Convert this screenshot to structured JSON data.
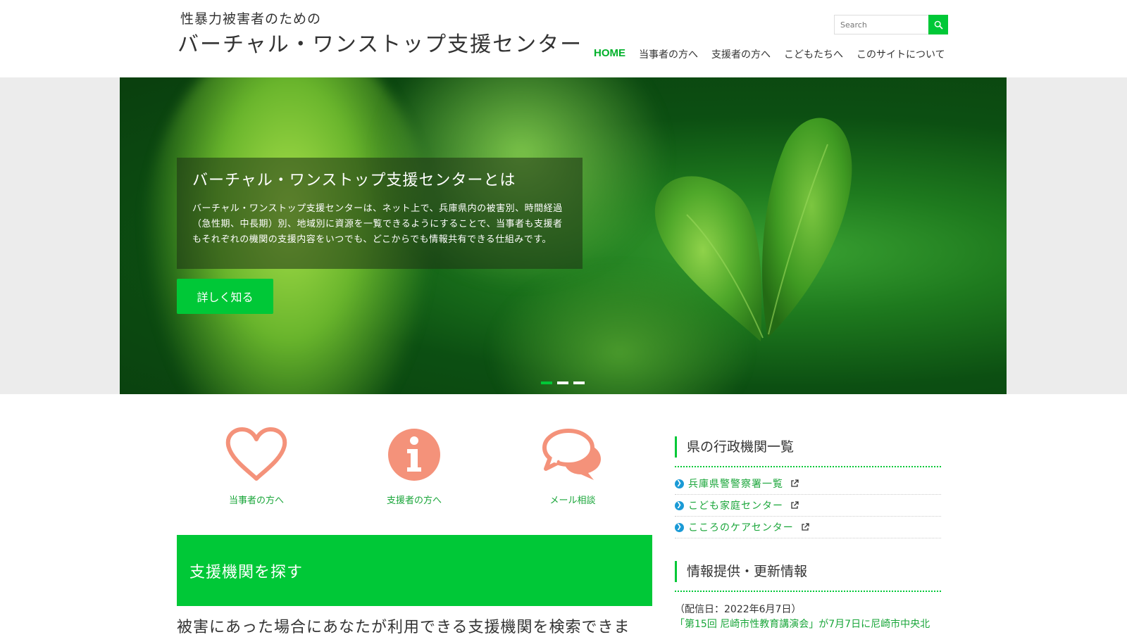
{
  "header": {
    "logo_sub": "性暴力被害者のための",
    "logo_main": "バーチャル・ワンストップ支援センター",
    "search_placeholder": "Search"
  },
  "nav": [
    {
      "label": "HOME",
      "active": true
    },
    {
      "label": "当事者の方へ",
      "active": false
    },
    {
      "label": "支援者の方へ",
      "active": false
    },
    {
      "label": "こどもたちへ",
      "active": false
    },
    {
      "label": "このサイトについて",
      "active": false
    }
  ],
  "hero": {
    "title": "バーチャル・ワンストップ支援センターとは",
    "body": "バーチャル・ワンストップ支援センターは、ネット上で、兵庫県内の被害別、時間経過（急性期、中長期）別、地域別に資源を一覧できるようにすることで、当事者も支援者もそれぞれの機関の支援内容をいつでも、どこからでも情報共有できる仕組みです。",
    "button_label": "詳しく知る",
    "slide_count": 3,
    "active_slide": 1
  },
  "icon_links": [
    {
      "label": "当事者の方へ",
      "icon": "heart-icon"
    },
    {
      "label": "支援者の方へ",
      "icon": "info-icon"
    },
    {
      "label": "メール相談",
      "icon": "chat-bubbles-icon"
    }
  ],
  "find": {
    "title": "支援機関を探す",
    "description": "被害にあった場合にあなたが利用できる支援機関を検索できま"
  },
  "sidebar": {
    "agencies_title": "県の行政機関一覧",
    "agencies": [
      {
        "label": "兵庫県警警察署一覧"
      },
      {
        "label": "こども家庭センター"
      },
      {
        "label": "こころのケアセンター"
      }
    ],
    "news_title": "情報提供・更新情報",
    "news_date": "（配信日：2022年6月7日）",
    "news_link": "「第15回 尼崎市性教育講演会」が7月7日に尼崎市中央北"
  },
  "colors": {
    "accent": "#00c837",
    "link": "#1aa63a",
    "icon": "#f4927a"
  }
}
